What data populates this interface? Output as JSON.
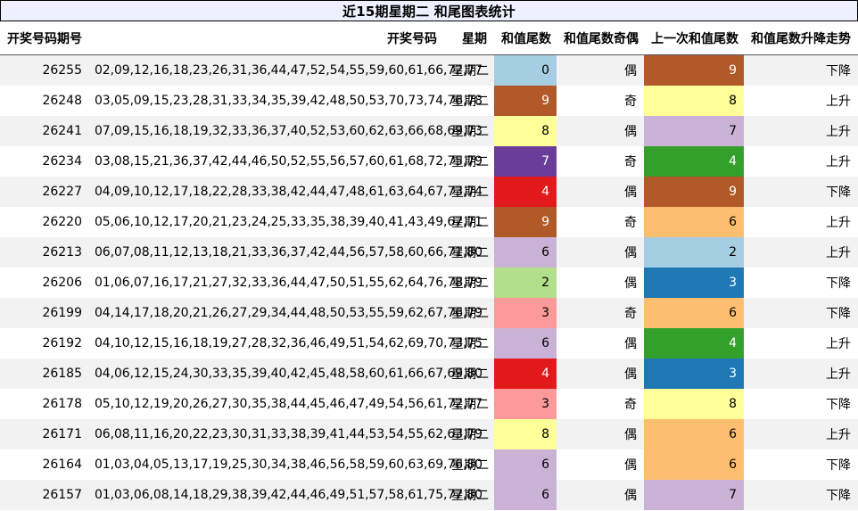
{
  "title": "近15期星期二 和尾图表统计",
  "headers": {
    "issue": "开奖号码期号",
    "numbers": "开奖号码",
    "weekday": "星期",
    "tail": "和值尾数",
    "parity": "和值尾数奇偶",
    "prev_tail": "上一次和值尾数",
    "trend": "和值尾数升降走势"
  },
  "tail_colors": {
    "0": "#a6cee3",
    "2": "#b2df8a",
    "3": "#fb9a99",
    "4": "#e31a1c",
    "6": "#cab2d6",
    "7": "#6a3d9a",
    "8": "#ffff99",
    "9": "#b15928"
  },
  "prev_colors": {
    "2": "#a6cee3",
    "3": "#1f78b4",
    "4": "#33a02c",
    "6": "#fdbf6f",
    "7": "#cab2d6",
    "8": "#ffff99",
    "9": "#b15928"
  },
  "rows": [
    {
      "issue": "26255",
      "numbers": "02,09,12,16,18,23,26,31,36,44,47,52,54,55,59,60,61,66,72,77",
      "weekday": "星期二",
      "tail": "0",
      "parity": "偶",
      "prev_tail": "9",
      "trend": "下降"
    },
    {
      "issue": "26248",
      "numbers": "03,05,09,15,23,28,31,33,34,35,39,42,48,50,53,70,73,74,76,78",
      "weekday": "星期二",
      "tail": "9",
      "parity": "奇",
      "prev_tail": "8",
      "trend": "上升"
    },
    {
      "issue": "26241",
      "numbers": "07,09,15,16,18,19,32,33,36,37,40,52,53,60,62,63,66,68,69,73",
      "weekday": "星期二",
      "tail": "8",
      "parity": "偶",
      "prev_tail": "7",
      "trend": "上升"
    },
    {
      "issue": "26234",
      "numbers": "03,08,15,21,36,37,42,44,46,50,52,55,56,57,60,61,68,72,75,79",
      "weekday": "星期二",
      "tail": "7",
      "parity": "奇",
      "prev_tail": "4",
      "trend": "上升"
    },
    {
      "issue": "26227",
      "numbers": "04,09,10,12,17,18,22,28,33,38,42,44,47,48,61,63,64,67,73,74",
      "weekday": "星期二",
      "tail": "4",
      "parity": "偶",
      "prev_tail": "9",
      "trend": "下降"
    },
    {
      "issue": "26220",
      "numbers": "05,06,10,12,17,20,21,23,24,25,33,35,38,39,40,41,43,49,67,71",
      "weekday": "星期二",
      "tail": "9",
      "parity": "奇",
      "prev_tail": "6",
      "trend": "上升"
    },
    {
      "issue": "26213",
      "numbers": "06,07,08,11,12,13,18,21,33,36,37,42,44,56,57,58,60,66,71,80",
      "weekday": "星期二",
      "tail": "6",
      "parity": "偶",
      "prev_tail": "2",
      "trend": "上升"
    },
    {
      "issue": "26206",
      "numbers": "01,06,07,16,17,21,27,32,33,36,44,47,50,51,55,62,64,76,78,79",
      "weekday": "星期二",
      "tail": "2",
      "parity": "偶",
      "prev_tail": "3",
      "trend": "下降"
    },
    {
      "issue": "26199",
      "numbers": "04,14,17,18,20,21,26,27,29,34,44,48,50,53,55,59,62,67,76,79",
      "weekday": "星期二",
      "tail": "3",
      "parity": "奇",
      "prev_tail": "6",
      "trend": "下降"
    },
    {
      "issue": "26192",
      "numbers": "04,10,12,15,16,18,19,27,28,32,36,46,49,51,54,62,69,70,73,75",
      "weekday": "星期二",
      "tail": "6",
      "parity": "偶",
      "prev_tail": "4",
      "trend": "上升"
    },
    {
      "issue": "26185",
      "numbers": "04,06,12,15,24,30,33,35,39,40,42,45,48,58,60,61,66,67,69,80",
      "weekday": "星期二",
      "tail": "4",
      "parity": "偶",
      "prev_tail": "3",
      "trend": "上升"
    },
    {
      "issue": "26178",
      "numbers": "05,10,12,19,20,26,27,30,35,38,44,45,46,47,49,54,56,61,72,77",
      "weekday": "星期二",
      "tail": "3",
      "parity": "奇",
      "prev_tail": "8",
      "trend": "下降"
    },
    {
      "issue": "26171",
      "numbers": "06,08,11,16,20,22,23,30,31,33,38,39,41,44,53,54,55,62,63,79",
      "weekday": "星期二",
      "tail": "8",
      "parity": "偶",
      "prev_tail": "6",
      "trend": "上升"
    },
    {
      "issue": "26164",
      "numbers": "01,03,04,05,13,17,19,25,30,34,38,46,56,58,59,60,63,69,76,80",
      "weekday": "星期二",
      "tail": "6",
      "parity": "偶",
      "prev_tail": "6",
      "trend": "下降"
    },
    {
      "issue": "26157",
      "numbers": "01,03,06,08,14,18,29,38,39,42,44,46,49,51,57,58,61,75,77,80",
      "weekday": "星期二",
      "tail": "6",
      "parity": "偶",
      "prev_tail": "7",
      "trend": "下降"
    }
  ]
}
